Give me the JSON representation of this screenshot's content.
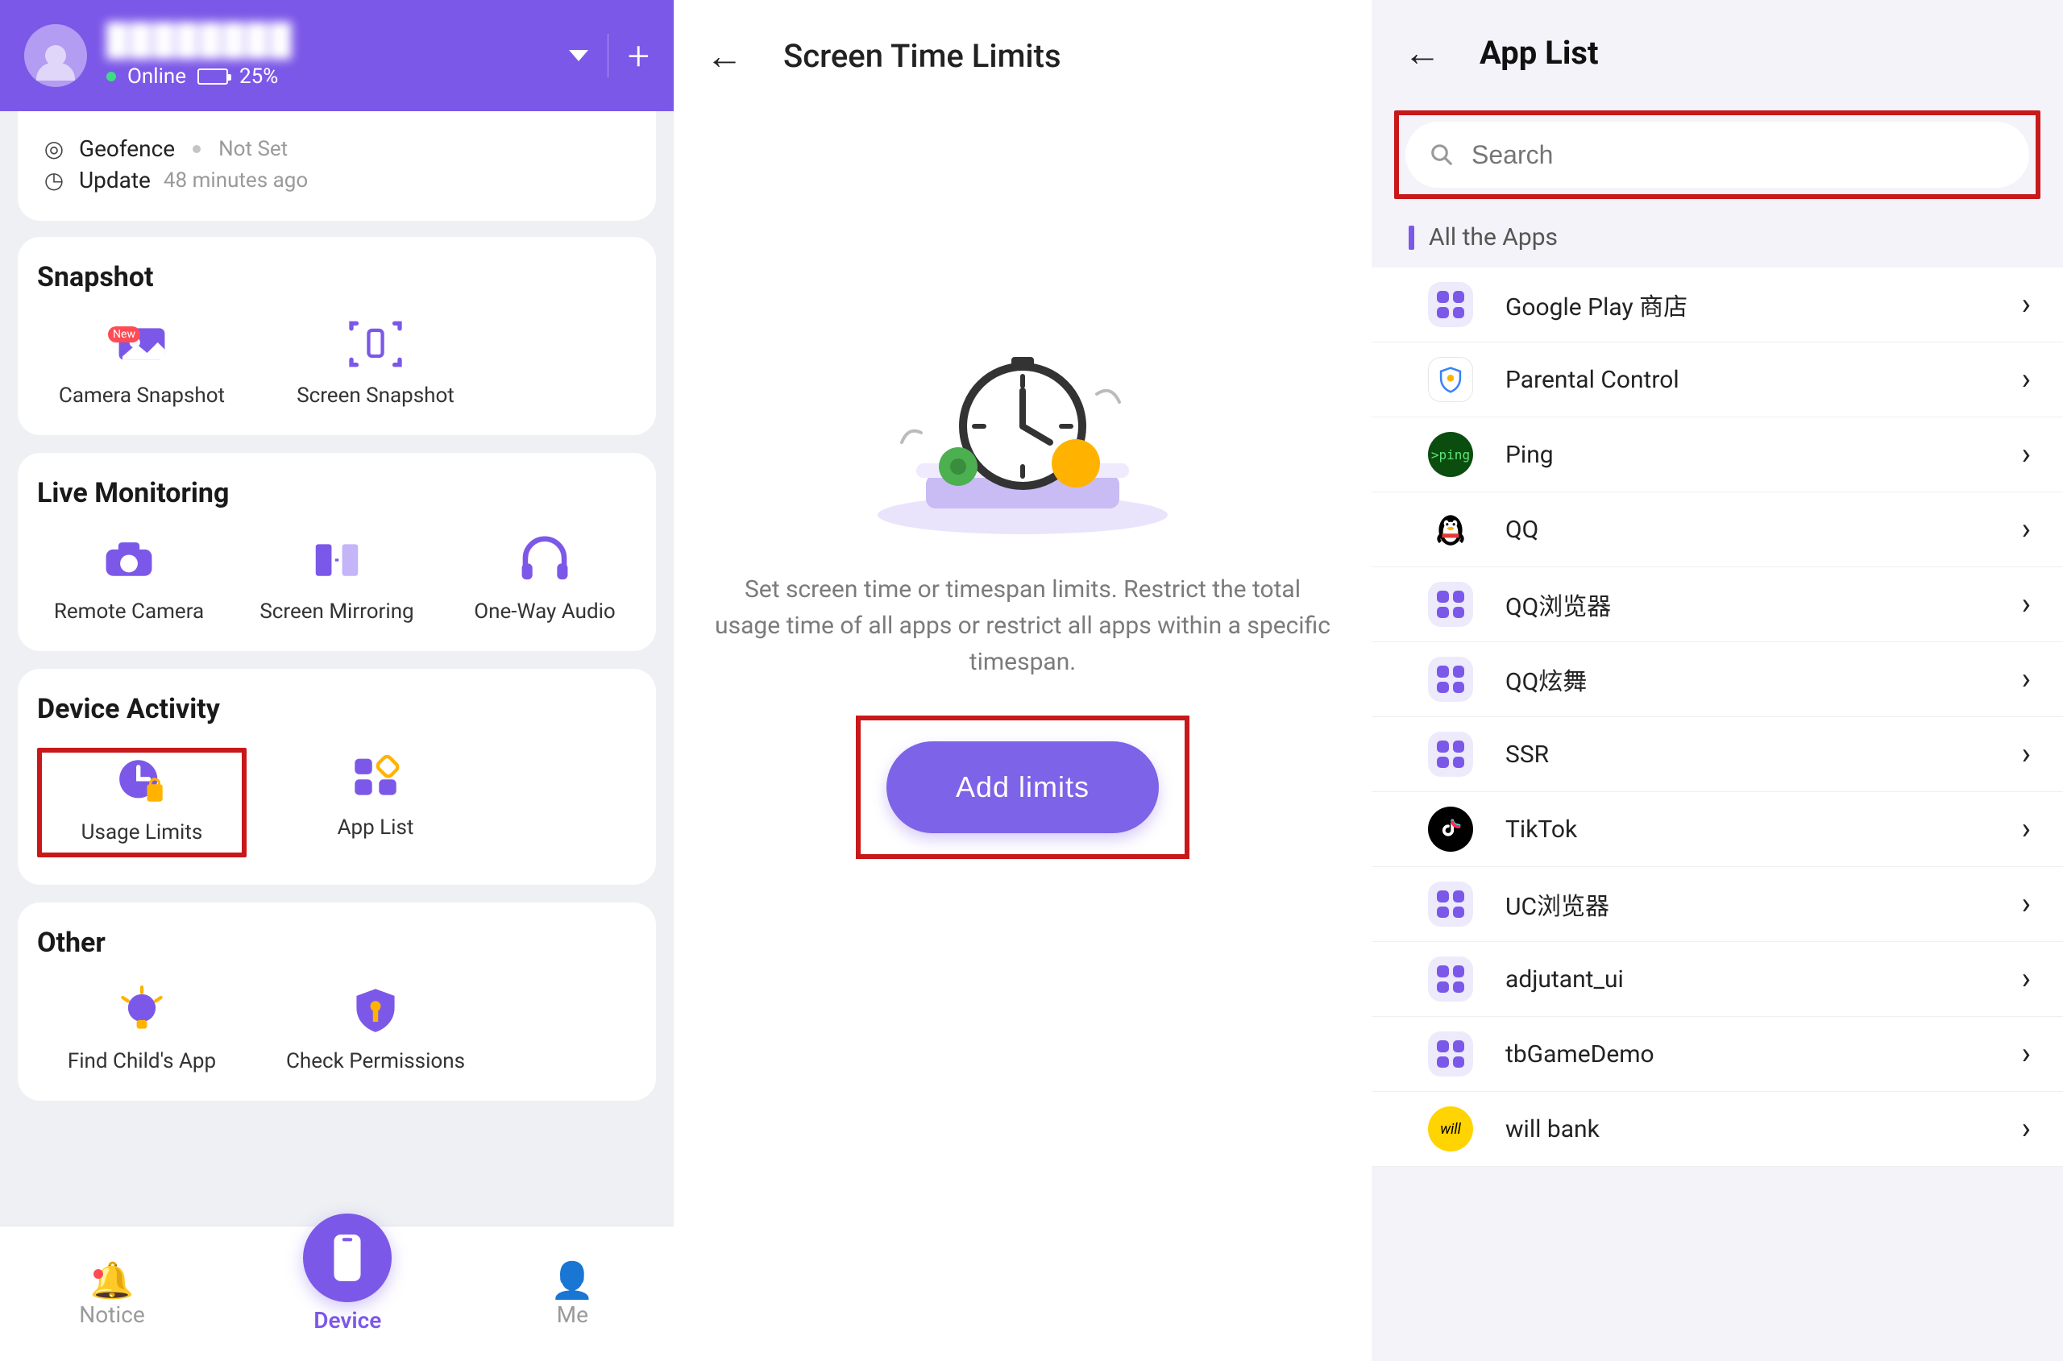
{
  "phone1": {
    "child_name": "████████",
    "online": "Online",
    "battery": "25%",
    "geofence_label": "Geofence",
    "geofence_value": "Not Set",
    "update_label": "Update",
    "update_value": "48 minutes ago",
    "snapshot": {
      "title": "Snapshot",
      "camera": "Camera Snapshot",
      "screen": "Screen Snapshot",
      "new_badge": "New"
    },
    "live": {
      "title": "Live Monitoring",
      "remote_camera": "Remote Camera",
      "screen_mirroring": "Screen Mirroring",
      "oneway_audio": "One-Way Audio"
    },
    "device_activity": {
      "title": "Device Activity",
      "usage_limits": "Usage Limits",
      "app_list": "App List"
    },
    "other": {
      "title": "Other",
      "find_child": "Find Child's App",
      "check_perm": "Check Permissions"
    },
    "tabs": {
      "notice": "Notice",
      "device": "Device",
      "me": "Me"
    }
  },
  "phone2": {
    "title": "Screen Time Limits",
    "description": "Set screen time or timespan limits. Restrict the total usage time of all apps or restrict all apps within a specific timespan.",
    "add_button": "Add limits"
  },
  "phone3": {
    "title": "App List",
    "search_placeholder": "Search",
    "section_label": "All the Apps",
    "apps": [
      {
        "name": "Google Play 商店",
        "icon": "grid"
      },
      {
        "name": "Parental Control",
        "icon": "shield"
      },
      {
        "name": "Ping",
        "icon": "ping"
      },
      {
        "name": "QQ",
        "icon": "qq"
      },
      {
        "name": "QQ浏览器",
        "icon": "grid"
      },
      {
        "name": "QQ炫舞",
        "icon": "grid"
      },
      {
        "name": "SSR",
        "icon": "grid"
      },
      {
        "name": "TikTok",
        "icon": "tiktok"
      },
      {
        "name": "UC浏览器",
        "icon": "grid"
      },
      {
        "name": "adjutant_ui",
        "icon": "grid"
      },
      {
        "name": "tbGameDemo",
        "icon": "grid"
      },
      {
        "name": "will bank",
        "icon": "will"
      }
    ]
  }
}
